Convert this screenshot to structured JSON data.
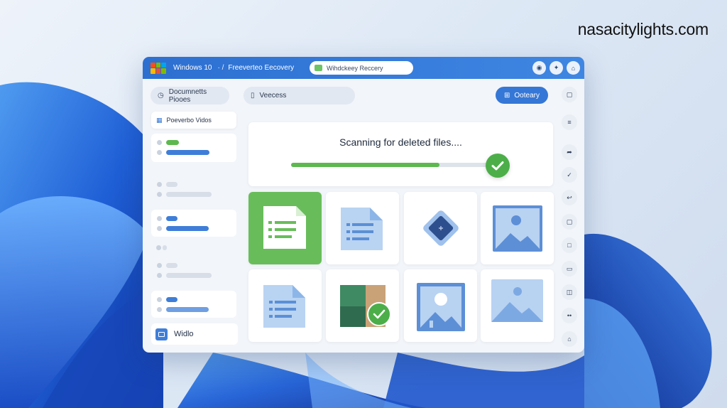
{
  "watermark": "nasacitylights.com",
  "window": {
    "title": "Windows 10",
    "title_separator": "· /",
    "app_name": "Freeverteo Eecovery",
    "search_value": "Wihdckeey Reccery",
    "title_controls": [
      "◉",
      "✦",
      "⌂"
    ]
  },
  "toolbar": {
    "location_label": "Documnetts Piooes",
    "filter_label": "Veecess",
    "recovery_button": "Ooteary"
  },
  "sidebar": {
    "header_label": "Poeverbo Vidos",
    "footer_label": "Widlo"
  },
  "scan": {
    "status_text": "Scanning for deleted files....",
    "progress": 0.72
  },
  "rail": {
    "icons": [
      "▢",
      "≡",
      "➦",
      "✓",
      "↩",
      "▢",
      "□",
      "▭",
      "◫",
      "••",
      "⌂"
    ]
  },
  "colors": {
    "accent": "#3577d6",
    "success": "#4cae49",
    "titlebar": "#2c6fd1"
  }
}
